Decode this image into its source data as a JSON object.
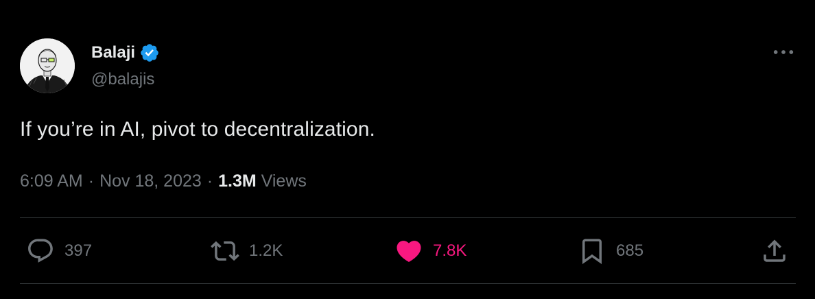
{
  "author": {
    "display_name": "Balaji",
    "handle": "@balajis",
    "verified": true,
    "avatar_icon": "avatar-sketch-portrait"
  },
  "tweet": {
    "text": "If you’re in AI, pivot to decentralization."
  },
  "meta": {
    "time": "6:09 AM",
    "separator": "·",
    "date": "Nov 18, 2023",
    "views_count": "1.3M",
    "views_label": "Views"
  },
  "actions": {
    "reply": {
      "icon": "reply-icon",
      "count": "397"
    },
    "retweet": {
      "icon": "retweet-icon",
      "count": "1.2K"
    },
    "like": {
      "icon": "heart-icon",
      "count": "7.8K",
      "liked": true
    },
    "bookmark": {
      "icon": "bookmark-icon",
      "count": "685"
    },
    "share": {
      "icon": "share-icon"
    }
  },
  "colors": {
    "background": "#000000",
    "text_primary": "#e7e9ea",
    "text_secondary": "#71767b",
    "verified_blue": "#1d9bf0",
    "like_pink": "#f91880",
    "divider": "#2f3336"
  }
}
